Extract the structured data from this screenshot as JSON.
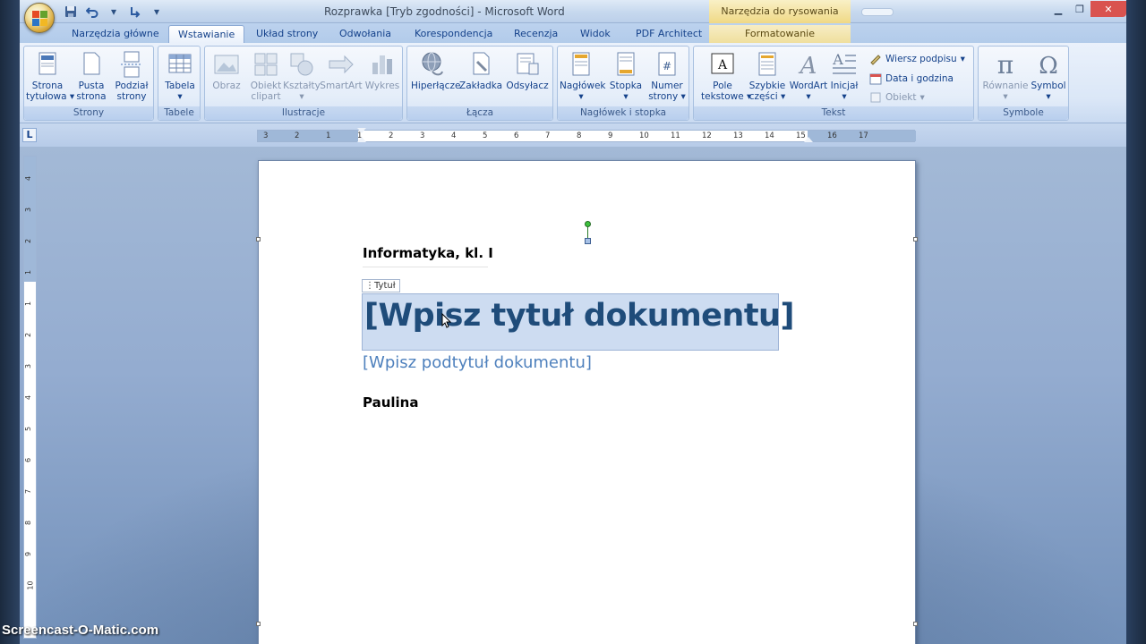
{
  "window": {
    "title": "Rozprawka [Tryb zgodności] - Microsoft Word",
    "context_tool": "Narzędzia do rysowania"
  },
  "tabs": [
    {
      "label": "Narzędzia główne"
    },
    {
      "label": "Wstawianie"
    },
    {
      "label": "Układ strony"
    },
    {
      "label": "Odwołania"
    },
    {
      "label": "Korespondencja"
    },
    {
      "label": "Recenzja"
    },
    {
      "label": "Widok"
    },
    {
      "label": "PDF Architect"
    },
    {
      "label": "Formatowanie"
    }
  ],
  "ribbon": {
    "groups": {
      "strony": "Strony",
      "tabele": "Tabele",
      "ilustracje": "Ilustracje",
      "lacza": "Łącza",
      "naglowek": "Nagłówek i stopka",
      "tekst": "Tekst",
      "symbole": "Symbole"
    },
    "buttons": {
      "strona_tytulowa": [
        "Strona",
        "tytułowa"
      ],
      "pusta_strona": [
        "Pusta",
        "strona"
      ],
      "podzial_strony": [
        "Podział",
        "strony"
      ],
      "tabela": [
        "Tabela"
      ],
      "obraz": [
        "Obraz"
      ],
      "obiekt_clipart": [
        "Obiekt",
        "clipart"
      ],
      "ksztalty": [
        "Kształty"
      ],
      "smartart": [
        "SmartArt"
      ],
      "wykres": [
        "Wykres"
      ],
      "hiperlacze": [
        "Hiperłącze"
      ],
      "zakladka": [
        "Zakładka"
      ],
      "odsylacz": [
        "Odsyłacz"
      ],
      "naglowek": [
        "Nagłówek"
      ],
      "stopka": [
        "Stopka"
      ],
      "numer_strony": [
        "Numer",
        "strony"
      ],
      "pole_tekstowe": [
        "Pole",
        "tekstowe"
      ],
      "szybkie_czesci": [
        "Szybkie",
        "części"
      ],
      "wordart": [
        "WordArt"
      ],
      "inicjal": [
        "Inicjał"
      ],
      "rownanie": [
        "Równanie"
      ],
      "symbol": [
        "Symbol"
      ]
    },
    "small_buttons": {
      "wiersz_podpisu": "Wiersz podpisu",
      "data_godzina": "Data i godzina",
      "obiekt": "Obiekt"
    }
  },
  "ruler": {
    "ticks": [
      "3",
      "2",
      "1",
      "1",
      "2",
      "3",
      "4",
      "5",
      "6",
      "7",
      "8",
      "9",
      "10",
      "11",
      "12",
      "13",
      "14",
      "15",
      "16",
      "17"
    ],
    "vticks": [
      "4",
      "3",
      "2",
      "1",
      "1",
      "2",
      "3",
      "4",
      "5",
      "6",
      "7",
      "8",
      "9",
      "10"
    ],
    "corner": "L"
  },
  "document": {
    "company": "Informatyka, kl. I",
    "content_control_tag": "Tytuł",
    "title": "[Wpisz tytuł dokumentu]",
    "subtitle": "[Wpisz podtytuł dokumentu]",
    "author": "Paulina"
  },
  "watermark": "Screencast-O-Matic.com",
  "colors": {
    "title_text": "#1f4c7a",
    "subtitle_text": "#4f81bd",
    "selection": "#cddcf1"
  }
}
